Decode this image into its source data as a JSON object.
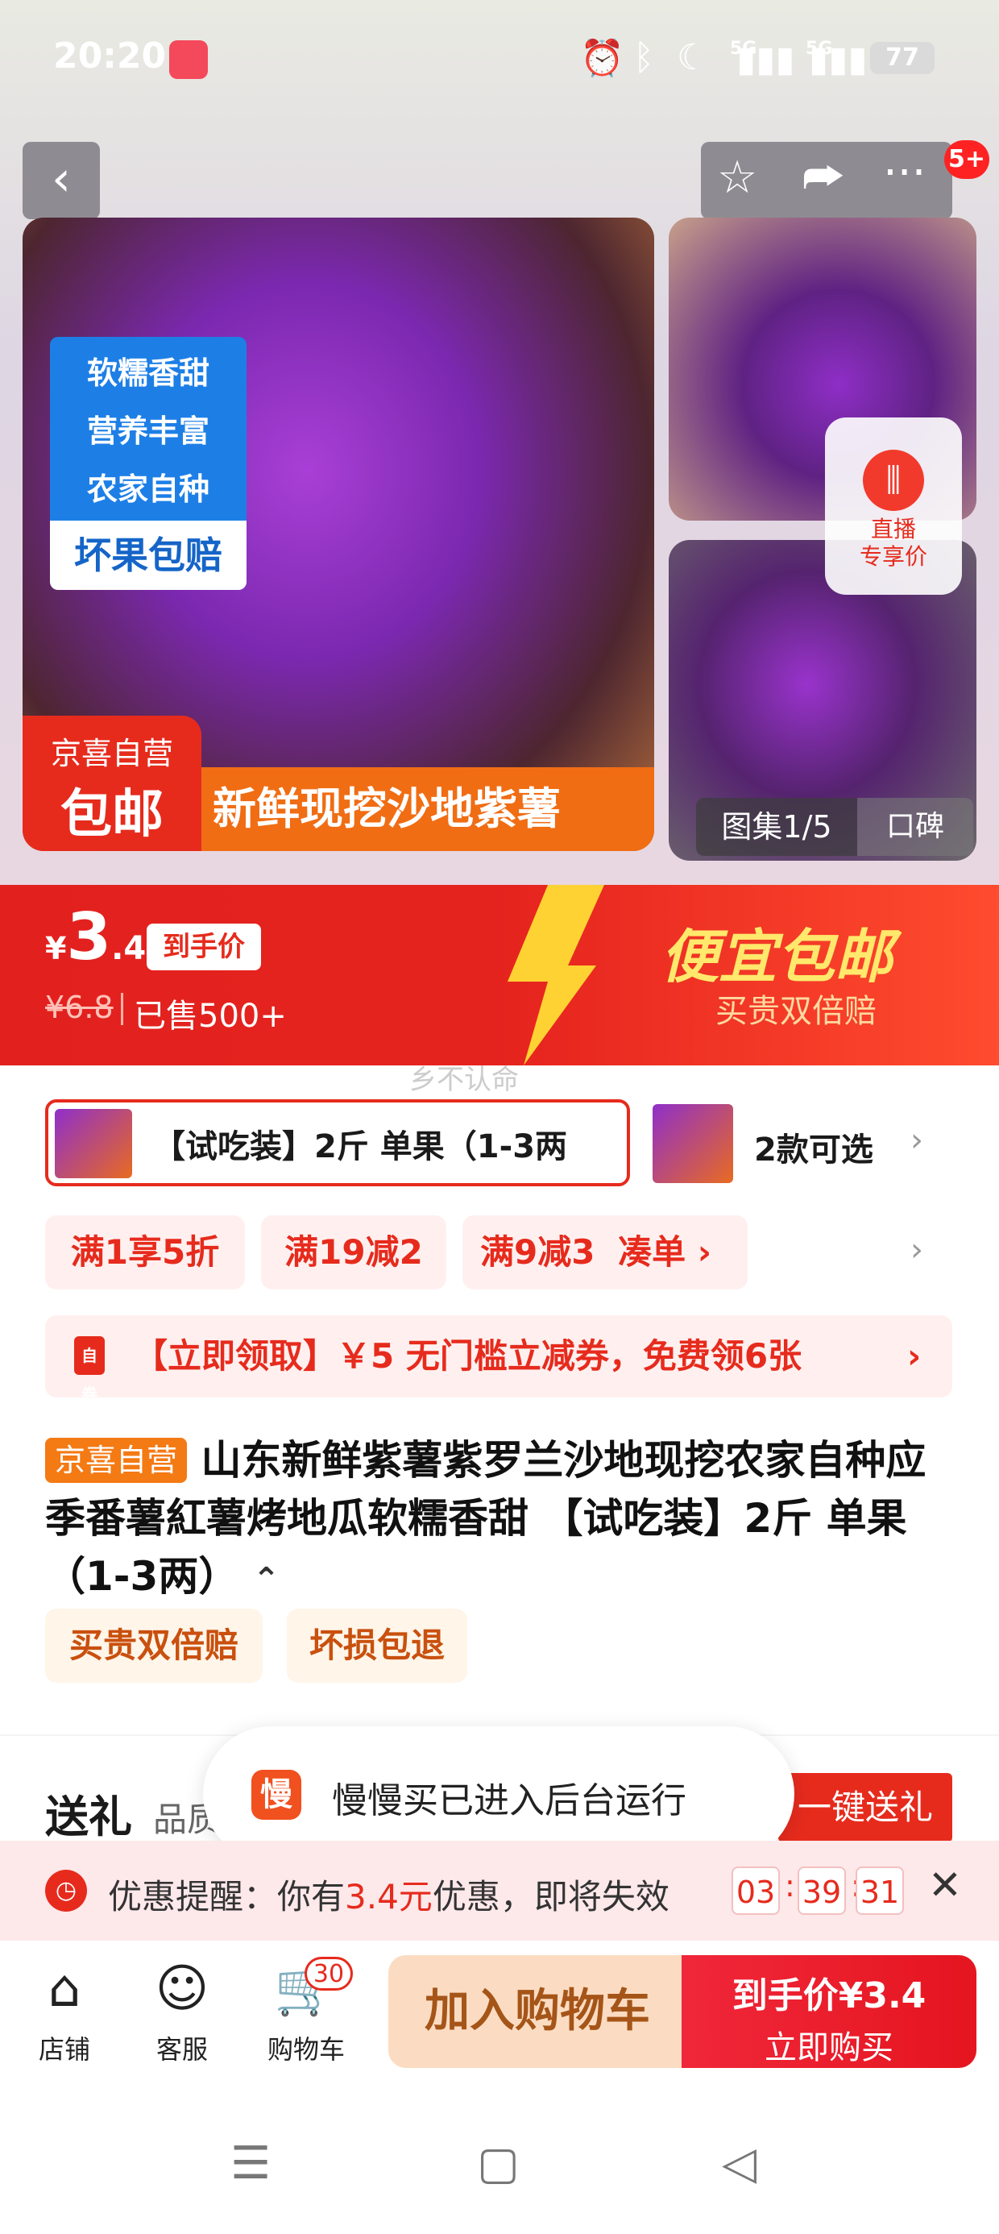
{
  "status_bar": {
    "time": "20:20",
    "network1": "5G",
    "network2": "5G",
    "battery": "77",
    "icons": [
      "alarm-icon",
      "bluetooth-icon",
      "moon-icon",
      "signal-icon",
      "signal-icon",
      "battery-icon"
    ]
  },
  "header": {
    "back": "‹",
    "star": "☆",
    "share": "⮫",
    "more": "···",
    "badge": "5+"
  },
  "hero": {
    "tags": [
      "软糯香甜",
      "营养丰富",
      "农家自种"
    ],
    "tag_bottom": "坏果包赔",
    "self_line1": "京喜自营",
    "self_line2": "包邮",
    "banner": "新鲜现挖沙地紫薯",
    "live_line1": "直播",
    "live_line2": "专享价",
    "gallery": "图集1/5",
    "reviews": "口碑"
  },
  "price": {
    "currency": "¥",
    "integer": "3",
    "decimal": ".4",
    "badge": "到手价",
    "original": "¥6.8",
    "sold": "已售500+",
    "slogan": "便宜包邮",
    "slogan_sub": "买贵双倍赔",
    "watermark": "乡不认命"
  },
  "spec": {
    "selected": "【试吃装】2斤 单果（1-3两",
    "options_count": "2款可选",
    "chevron": "›"
  },
  "promos": [
    "满1享5折",
    "满19减2",
    "满9减3"
  ],
  "promo_link": "凑单 ›",
  "coupon": {
    "icon": "自券",
    "text": "【立即领取】￥5 无门槛立减券，免费领6张"
  },
  "product": {
    "tag": "京喜自营",
    "title": "山东新鲜紫薯紫罗兰沙地现挖农家自种应季番薯紅薯烤地瓜软糯香甜 【试吃装】2斤 单果（1-3两）",
    "collapse": "⌃",
    "services": [
      "买贵双倍赔",
      "坏损包退"
    ]
  },
  "gift": {
    "title": "送礼",
    "subtitle": "品质",
    "button": "一键送礼"
  },
  "toast": {
    "icon": "慢",
    "text": "慢慢买已进入后台运行"
  },
  "reminder": {
    "label": "优惠提醒：你有",
    "amount": "3.4元",
    "suffix": "优惠，即将失效",
    "hh": "03",
    "mm": "39",
    "ss": "31",
    "close": "✕"
  },
  "bottom": {
    "store": "店铺",
    "service": "客服",
    "cart": "购物车",
    "cart_count": "30",
    "add_cart": "加入购物车",
    "buy_price": "到手价¥3.4",
    "buy_now": "立即购买"
  },
  "nav": {
    "menu": "☰",
    "home": "▢",
    "back": "◁"
  },
  "colors": {
    "accent_red": "#e62b1d",
    "orange": "#f06d14",
    "gold": "#ffe86b"
  }
}
